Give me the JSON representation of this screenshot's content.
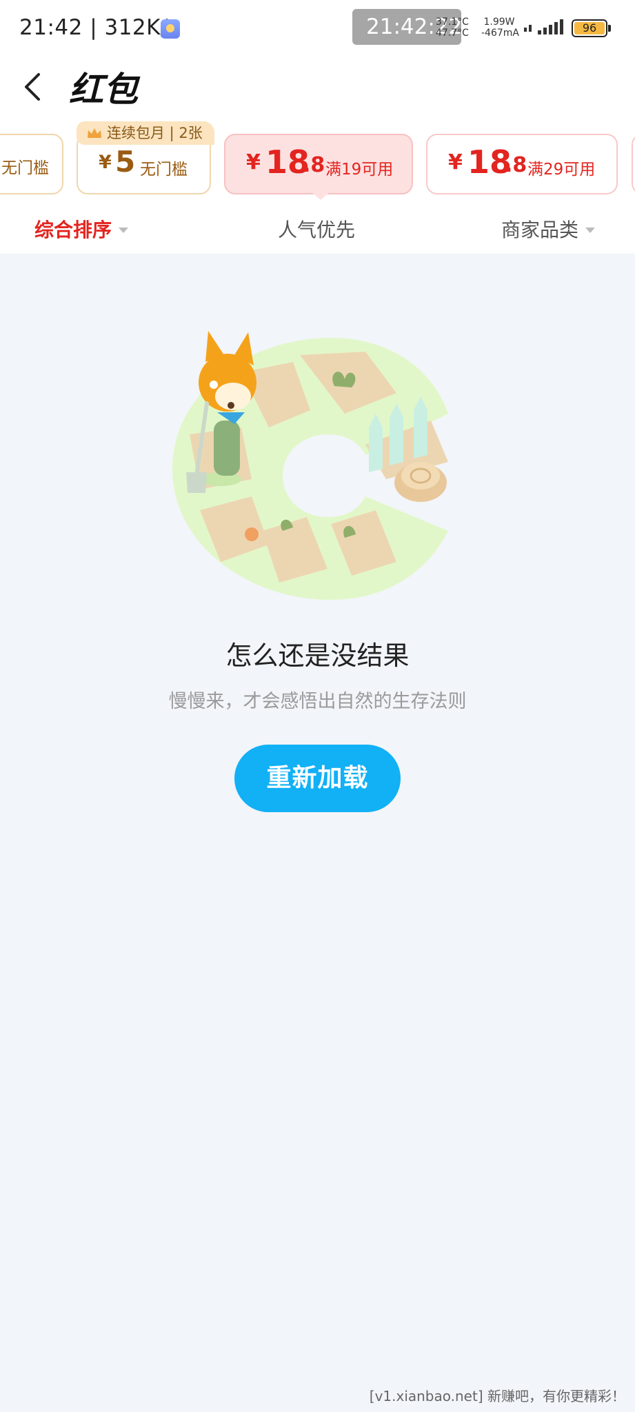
{
  "status_bar": {
    "time": "21:42 | 312K/s",
    "clock_overlay": "21:42:22",
    "temp_line1": "37.1°C",
    "temp_line2": "47.7°C",
    "power_line1": "1.99W",
    "power_line2": "-467mA",
    "battery_level": "96"
  },
  "header": {
    "title": "红包"
  },
  "coupons": [
    {
      "price": "",
      "condition": "无门槛",
      "style": "gold"
    },
    {
      "badge": "连续包月 | 2张",
      "currency": "¥",
      "price": "5",
      "condition": "无门槛",
      "style": "gold"
    },
    {
      "currency": "¥",
      "price_int": "18",
      "price_dec": ".8",
      "condition": "满19可用",
      "style": "red",
      "selected": true
    },
    {
      "currency": "¥",
      "price_int": "18",
      "price_dec": ".8",
      "condition": "满29可用",
      "style": "red"
    }
  ],
  "sort_bar": {
    "items": [
      {
        "label": "综合排序",
        "active": true,
        "has_caret": true
      },
      {
        "label": "人气优先",
        "active": false,
        "has_caret": false
      },
      {
        "label": "商家品类",
        "active": false,
        "has_caret": true
      }
    ]
  },
  "empty_state": {
    "title": "怎么还是没结果",
    "subtitle": "慢慢来，才会感悟出自然的生存法则",
    "button_label": "重新加载"
  },
  "watermark": "[v1.xianbao.net] 新赚吧，有你更精彩！",
  "colors": {
    "accent_red": "#e3241f",
    "gold_text": "#9a5b12",
    "button_blue": "#12b0f5",
    "page_bg": "#f2f5f9"
  },
  "icons": [
    "back-arrow-icon",
    "crown-icon",
    "caret-down-icon",
    "signal-icon",
    "battery-icon"
  ]
}
